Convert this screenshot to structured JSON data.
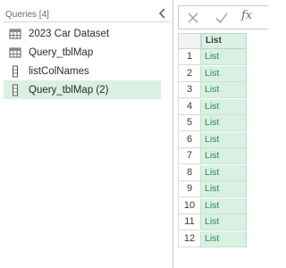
{
  "queries_pane": {
    "header": "Queries [4]",
    "items": [
      {
        "label": "2023 Car Dataset",
        "icon": "table-icon"
      },
      {
        "label": "Query_tblMap",
        "icon": "table-icon"
      },
      {
        "label": "listColNames",
        "icon": "list-icon"
      },
      {
        "label": "Query_tblMap (2)",
        "icon": "list-icon",
        "selected": true
      }
    ]
  },
  "formula_bar": {
    "cancel_icon": "close-icon",
    "confirm_icon": "check-icon",
    "function_label": "fx"
  },
  "grid": {
    "column_header": "List",
    "rows": [
      {
        "num": "1",
        "value": "List"
      },
      {
        "num": "2",
        "value": "List"
      },
      {
        "num": "3",
        "value": "List"
      },
      {
        "num": "4",
        "value": "List"
      },
      {
        "num": "5",
        "value": "List"
      },
      {
        "num": "6",
        "value": "List"
      },
      {
        "num": "7",
        "value": "List"
      },
      {
        "num": "8",
        "value": "List"
      },
      {
        "num": "9",
        "value": "List"
      },
      {
        "num": "10",
        "value": "List"
      },
      {
        "num": "11",
        "value": "List"
      },
      {
        "num": "12",
        "value": "List"
      }
    ]
  },
  "colors": {
    "selection_bg": "#daf0e3",
    "list_text": "#1f8f4f"
  }
}
